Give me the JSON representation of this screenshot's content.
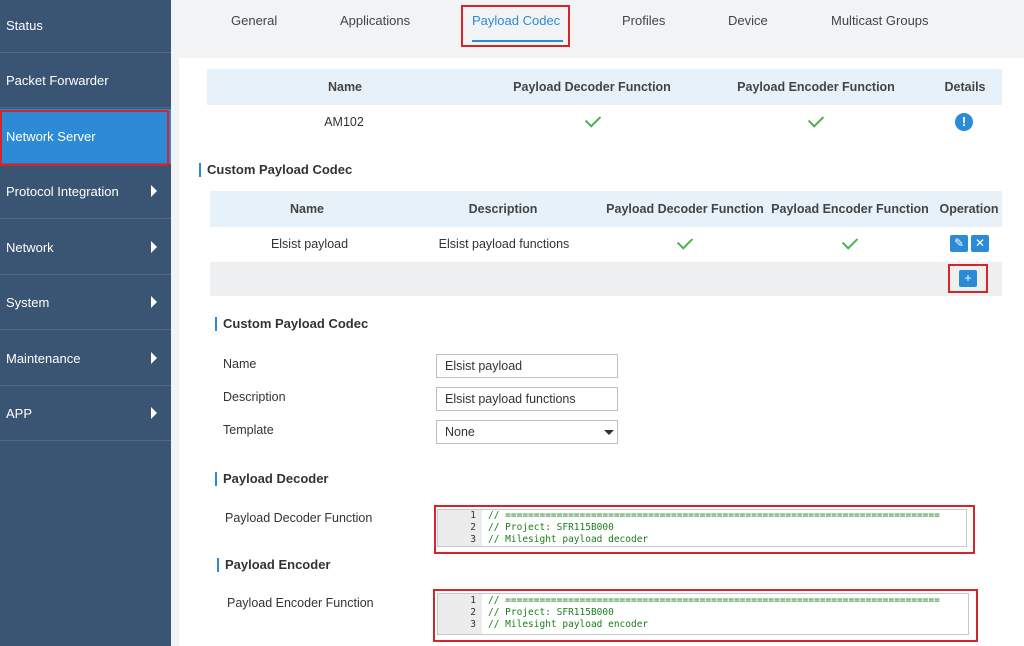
{
  "sidebar": {
    "items": [
      {
        "label": "Status",
        "has_arrow": false
      },
      {
        "label": "Packet Forwarder",
        "has_arrow": false
      },
      {
        "label": "Network Server",
        "has_arrow": false,
        "active": true
      },
      {
        "label": "Protocol Integration",
        "has_arrow": true
      },
      {
        "label": "Network",
        "has_arrow": true
      },
      {
        "label": "System",
        "has_arrow": true
      },
      {
        "label": "Maintenance",
        "has_arrow": true
      },
      {
        "label": "APP",
        "has_arrow": true
      }
    ]
  },
  "tabs": [
    {
      "label": "General"
    },
    {
      "label": "Applications"
    },
    {
      "label": "Payload Codec",
      "active": true
    },
    {
      "label": "Profiles"
    },
    {
      "label": "Device"
    },
    {
      "label": "Multicast Groups"
    }
  ],
  "default_codec_table": {
    "headers": [
      "Name",
      "Payload Decoder Function",
      "Payload Encoder Function",
      "Details"
    ],
    "rows": [
      {
        "name": "AM102",
        "decoder": "check-icon",
        "encoder": "check-icon",
        "details": "info-icon"
      }
    ]
  },
  "custom_section_title": "Custom Payload Codec",
  "custom_codec_table": {
    "headers": [
      "Name",
      "Description",
      "Payload Decoder Function",
      "Payload Encoder Function",
      "Operation"
    ],
    "rows": [
      {
        "name": "Elsist payload",
        "description": "Elsist payload functions",
        "decoder": "check-icon",
        "encoder": "check-icon"
      }
    ],
    "edit_icon": "pencil-icon",
    "delete_icon": "close-icon",
    "add_icon": "plus-icon",
    "add_glyph": "+"
  },
  "form": {
    "title": "Custom Payload Codec",
    "name_label": "Name",
    "name_value": "Elsist payload",
    "description_label": "Description",
    "description_value": "Elsist payload functions",
    "template_label": "Template",
    "template_value": "None"
  },
  "decoder": {
    "title": "Payload Decoder",
    "label": "Payload Decoder Function",
    "lines": [
      {
        "n": "1",
        "text": "// ============================================================================"
      },
      {
        "n": "2",
        "text": "// Project: SFR115B000"
      },
      {
        "n": "3",
        "text": "// Milesight payload decoder"
      }
    ]
  },
  "encoder": {
    "title": "Payload Encoder",
    "label": "Payload Encoder Function",
    "lines": [
      {
        "n": "1",
        "text": "// ============================================================================"
      },
      {
        "n": "2",
        "text": "// Project: SFR115B000"
      },
      {
        "n": "3",
        "text": "// Milesight payload encoder"
      }
    ]
  },
  "colors": {
    "sidebar_bg": "#3a5473",
    "active_blue": "#2d8ad6",
    "highlight_red": "#d3262c",
    "check_green": "#4caf50"
  }
}
